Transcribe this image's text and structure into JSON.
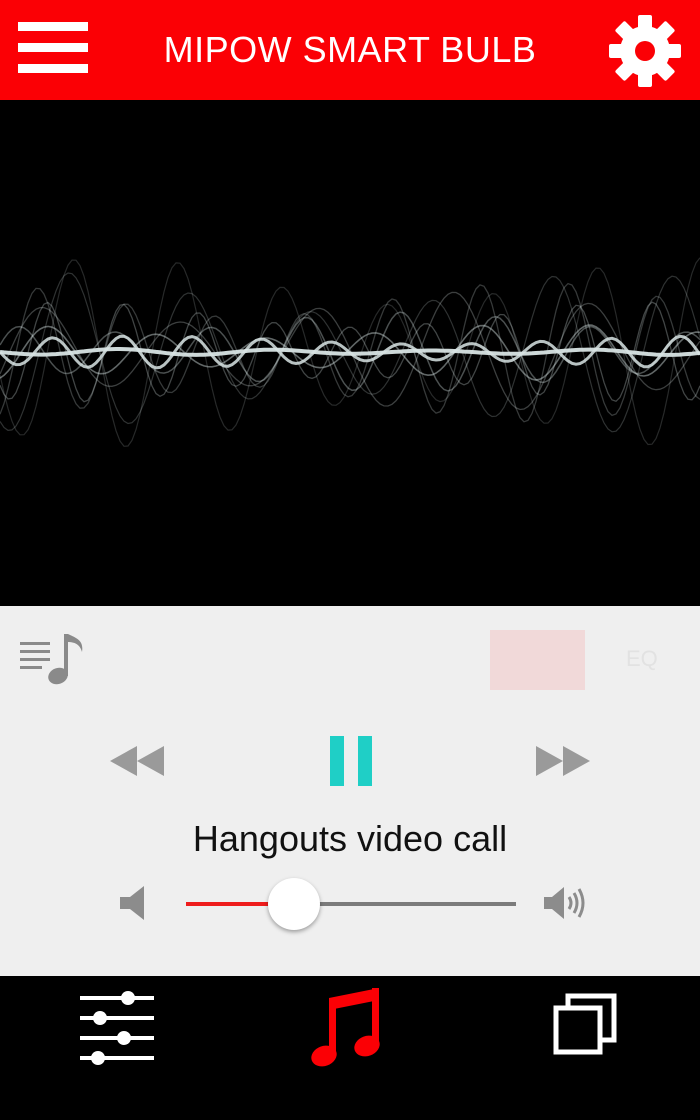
{
  "header": {
    "title": "MIPOW SMART BULB",
    "menu_icon": "hamburger-menu-icon",
    "settings_icon": "gear-icon",
    "background_color": "#fb0005"
  },
  "visualizer": {
    "background_color": "#000000",
    "wave_color": "#d8e4e4"
  },
  "player": {
    "background_color": "#efefef",
    "playlist_icon": "playlist-music-icon",
    "controls": {
      "previous_icon": "rewind-icon",
      "pause_icon": "pause-icon",
      "next_icon": "fast-forward-icon",
      "pause_color": "#1fcfc6"
    },
    "track_title": "Hangouts video call",
    "volume": {
      "level": 0.25,
      "low_icon": "volume-low-icon",
      "high_icon": "volume-high-icon",
      "fill_color": "#ee1c1c"
    }
  },
  "tabbar": {
    "tabs": [
      {
        "icon": "sliders-icon",
        "active": false
      },
      {
        "icon": "music-note-icon",
        "active": true
      },
      {
        "icon": "copy-pages-icon",
        "active": false
      }
    ],
    "active_color": "#fb0005"
  }
}
